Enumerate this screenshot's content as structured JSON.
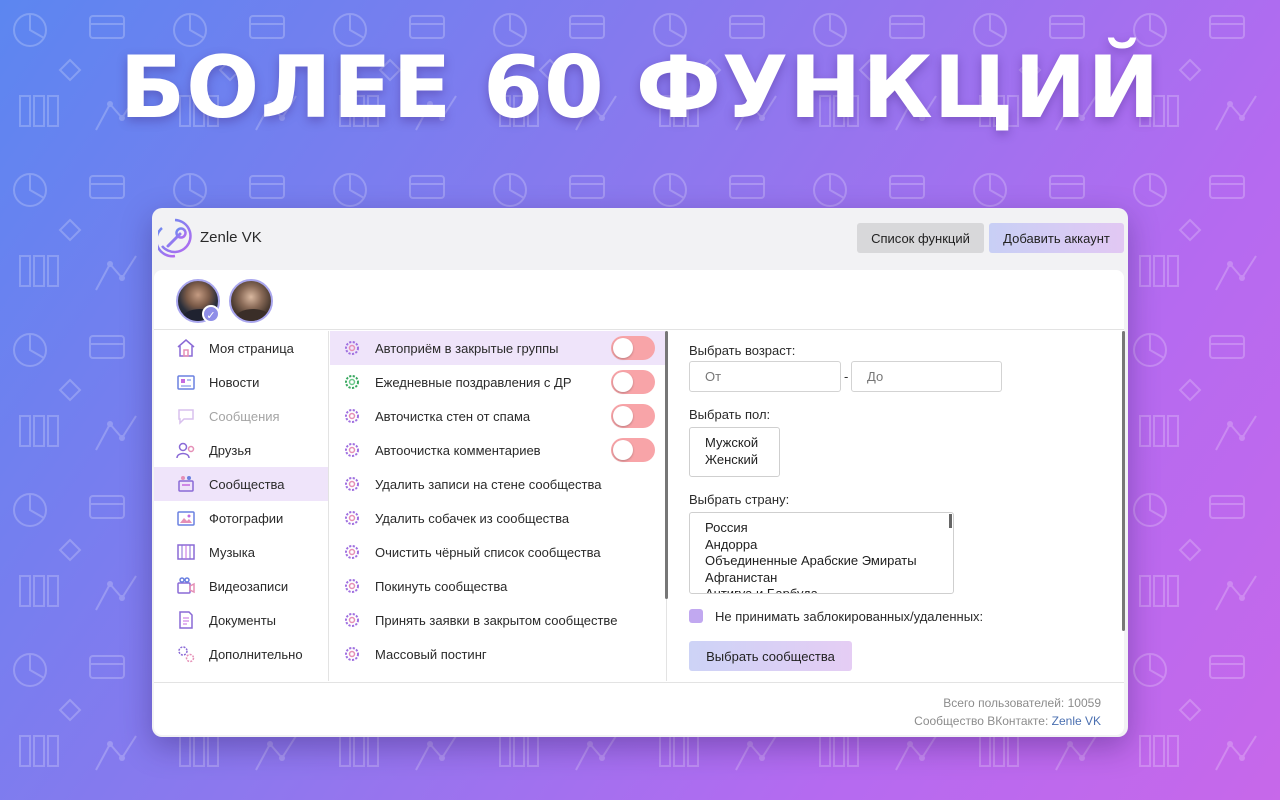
{
  "headline": "БОЛЕЕ 60 ФУНКЦИЙ",
  "app": {
    "title": "Zenle VK"
  },
  "header": {
    "functions_button": "Список функций",
    "add_account_button": "Добавить аккаунт"
  },
  "accounts": {
    "verified_mark": "✓"
  },
  "sidebar": {
    "items": [
      {
        "label": "Моя страница",
        "icon": "home-icon"
      },
      {
        "label": "Новости",
        "icon": "newspaper-icon"
      },
      {
        "label": "Сообщения",
        "icon": "chat-icon",
        "muted": true
      },
      {
        "label": "Друзья",
        "icon": "friends-icon"
      },
      {
        "label": "Сообщества",
        "icon": "community-icon",
        "active": true
      },
      {
        "label": "Фотографии",
        "icon": "photo-icon"
      },
      {
        "label": "Музыка",
        "icon": "music-icon"
      },
      {
        "label": "Видеозаписи",
        "icon": "video-icon"
      },
      {
        "label": "Документы",
        "icon": "document-icon"
      },
      {
        "label": "Дополнительно",
        "icon": "gears-icon"
      }
    ]
  },
  "functions": {
    "items": [
      {
        "label": "Автоприём в закрытые группы",
        "toggle": true,
        "active": true
      },
      {
        "label": "Ежедневные поздравления с ДР",
        "toggle": true,
        "green": true
      },
      {
        "label": "Авточистка стен от спама",
        "toggle": true
      },
      {
        "label": "Автоочистка комментариев",
        "toggle": true
      },
      {
        "label": "Удалить записи на стене сообщества"
      },
      {
        "label": "Удалить собачек из сообщества"
      },
      {
        "label": "Очистить чёрный список сообщества"
      },
      {
        "label": "Покинуть сообщества"
      },
      {
        "label": "Принять заявки в закрытом сообществе"
      },
      {
        "label": "Массовый постинг"
      }
    ]
  },
  "settings": {
    "age_label": "Выбрать возраст:",
    "age_from_placeholder": "От",
    "age_dash": "-",
    "age_to_placeholder": "До",
    "gender_label": "Выбрать пол:",
    "gender_options": [
      "Мужской",
      "Женский"
    ],
    "country_label": "Выбрать страну:",
    "country_options": [
      "Россия",
      "Андорра",
      "Объединенные Арабские Эмираты",
      "Афганистан",
      "Антигуа и Барбуда"
    ],
    "skip_blocked_label": "Не принимать заблокированных/удаленных:",
    "select_button": "Выбрать сообщества"
  },
  "footer": {
    "total_users_label": "Всего пользователей:",
    "total_users_value": "10059",
    "community_label": "Сообщество ВКонтакте:",
    "community_link": "Zenle VK"
  },
  "colors": {
    "accent_gradient_start": "#c8cff5",
    "accent_gradient_end": "#e2c8f3",
    "toggle_off": "#f8a4a8",
    "active_row": "#efe4fa"
  }
}
